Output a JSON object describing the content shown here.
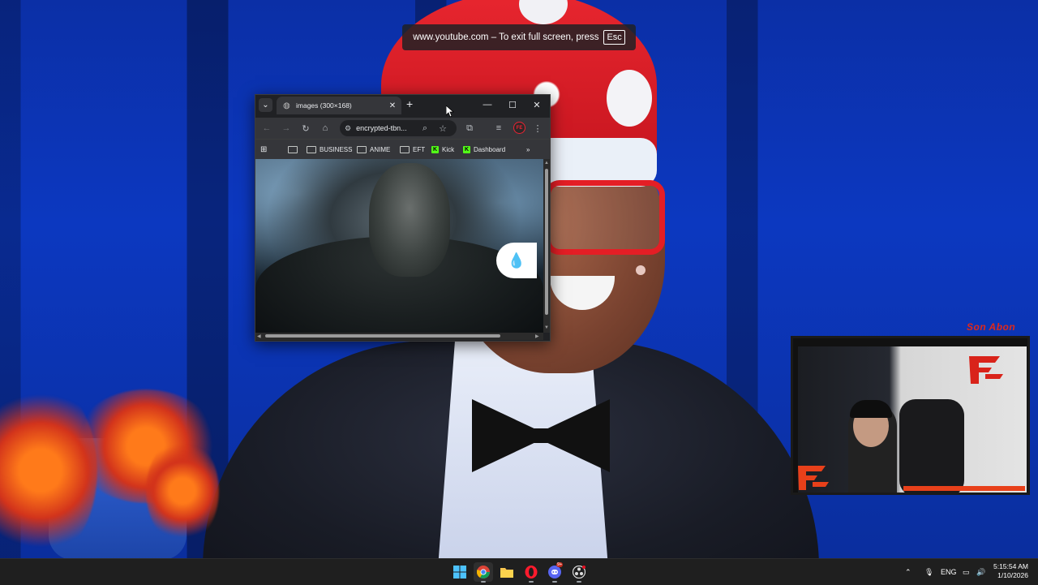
{
  "fullscreen_notice": {
    "text": "www.youtube.com – To exit full screen, press",
    "key": "Esc"
  },
  "browser": {
    "tab": {
      "title": "images (300×168)",
      "icon": "globe-icon"
    },
    "omnibox": {
      "url": "encrypted-tbn..."
    },
    "bookmarks": [
      {
        "label": "BUSINESS",
        "icon": "folder-icon"
      },
      {
        "label": "ANIME",
        "icon": "folder-icon"
      },
      {
        "label": "EFT",
        "icon": "folder-icon"
      },
      {
        "label": "Kick",
        "icon": "kick-icon"
      },
      {
        "label": "Dashboard",
        "icon": "kick-icon"
      }
    ],
    "page_image": "monster-image"
  },
  "overlay": {
    "son_abone": "Son Abon"
  },
  "taskbar": {
    "apps": [
      {
        "name": "windows-start",
        "icon": "windows-icon"
      },
      {
        "name": "chrome",
        "icon": "chrome-icon"
      },
      {
        "name": "file-explorer",
        "icon": "folder-icon"
      },
      {
        "name": "opera",
        "icon": "opera-icon"
      },
      {
        "name": "discord",
        "icon": "discord-icon",
        "badge": "9+"
      },
      {
        "name": "obs",
        "icon": "obs-icon"
      }
    ],
    "tray": {
      "language": "ENG",
      "time": "5:15:54 AM",
      "date": "1/10/2026"
    }
  },
  "colors": {
    "chrome_dark": "#202124",
    "chrome_toolbar": "#35363a",
    "accent_red": "#e0291b",
    "kick_green": "#53fc18"
  }
}
